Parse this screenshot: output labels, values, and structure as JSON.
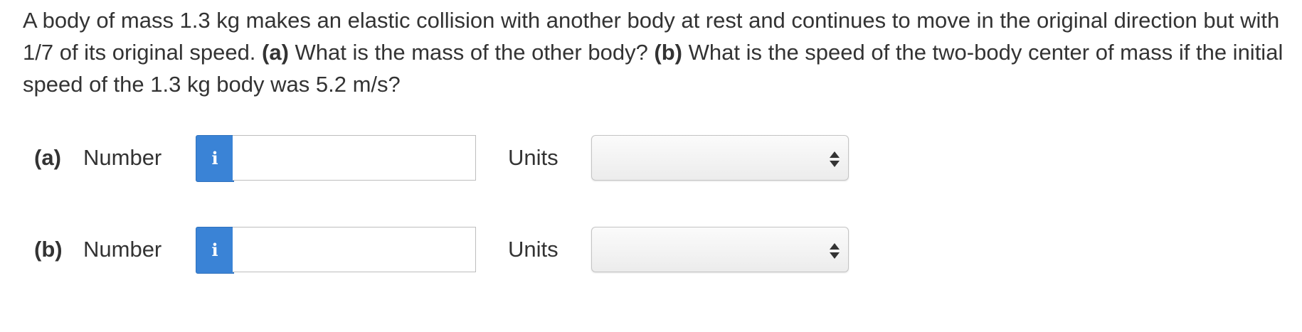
{
  "question": {
    "text_intro": "A body of mass 1.3 kg makes an elastic collision with another body at rest and continues to move in the original direction but with 1/7 of its original speed. ",
    "part_a_marker": "(a)",
    "part_a_text": " What is the mass of the other body? ",
    "part_b_marker": "(b)",
    "part_b_text": " What is the speed of the two-body center of mass if the initial speed of the 1.3 kg body was 5.2 m/s?"
  },
  "answers": [
    {
      "part_label": "(a)",
      "number_label": "Number",
      "info_icon": "info-icon",
      "info_glyph": "i",
      "number_value": "",
      "units_label": "Units",
      "units_selected": ""
    },
    {
      "part_label": "(b)",
      "number_label": "Number",
      "info_icon": "info-icon",
      "info_glyph": "i",
      "number_value": "",
      "units_label": "Units",
      "units_selected": ""
    }
  ],
  "colors": {
    "info_button": "#3a83d6",
    "text": "#333333"
  }
}
